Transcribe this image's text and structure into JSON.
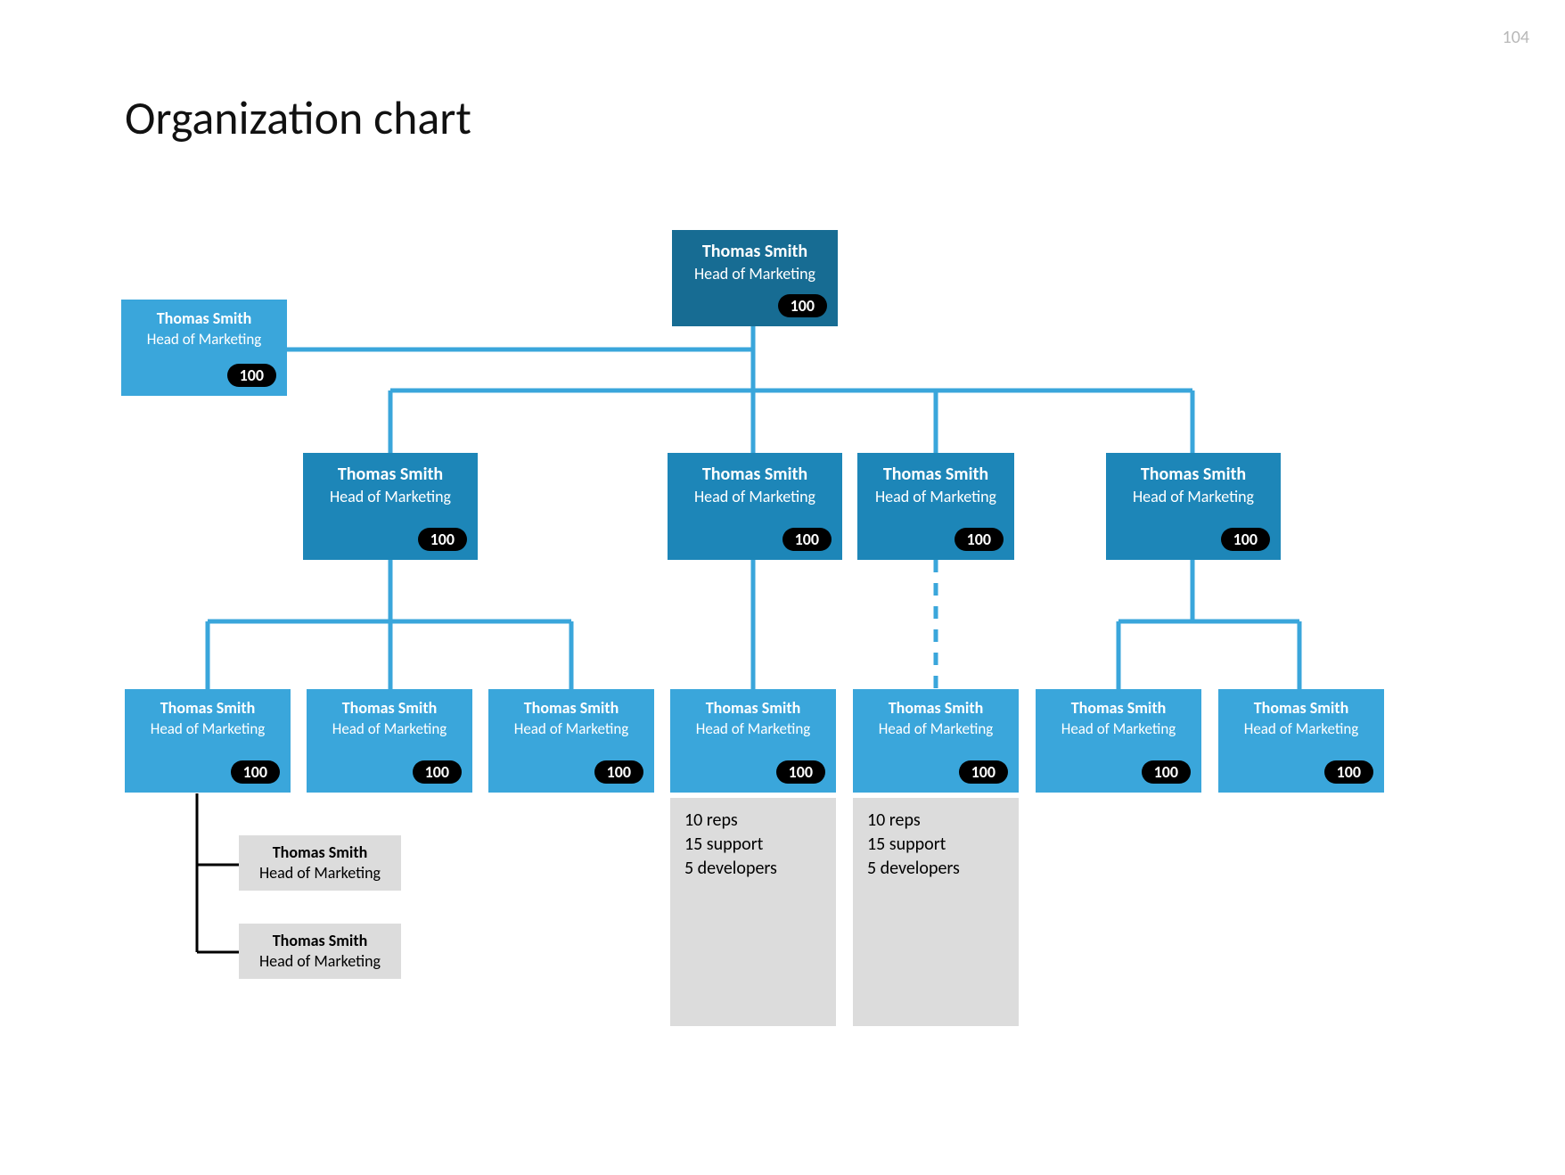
{
  "page_number": "104",
  "title": "Organization chart",
  "root": {
    "name": "Thomas Smith",
    "title": "Head of Marketing",
    "badge": "100"
  },
  "assistant": {
    "name": "Thomas Smith",
    "title": "Head of Marketing",
    "badge": "100"
  },
  "level2": [
    {
      "name": "Thomas Smith",
      "title": "Head of Marketing",
      "badge": "100"
    },
    {
      "name": "Thomas Smith",
      "title": "Head of Marketing",
      "badge": "100"
    },
    {
      "name": "Thomas Smith",
      "title": "Head of Marketing",
      "badge": "100"
    },
    {
      "name": "Thomas Smith",
      "title": "Head of Marketing",
      "badge": "100"
    }
  ],
  "level3": [
    {
      "name": "Thomas Smith",
      "title": "Head of Marketing",
      "badge": "100"
    },
    {
      "name": "Thomas Smith",
      "title": "Head of Marketing",
      "badge": "100"
    },
    {
      "name": "Thomas Smith",
      "title": "Head of Marketing",
      "badge": "100"
    },
    {
      "name": "Thomas Smith",
      "title": "Head of Marketing",
      "badge": "100"
    },
    {
      "name": "Thomas Smith",
      "title": "Head of Marketing",
      "badge": "100"
    },
    {
      "name": "Thomas Smith",
      "title": "Head of Marketing",
      "badge": "100"
    },
    {
      "name": "Thomas Smith",
      "title": "Head of Marketing",
      "badge": "100"
    }
  ],
  "subordinates": [
    {
      "name": "Thomas Smith",
      "title": "Head of Marketing"
    },
    {
      "name": "Thomas Smith",
      "title": "Head of Marketing"
    }
  ],
  "footnotes": [
    {
      "line1": "10 reps",
      "line2": "15 support",
      "line3": "5 developers"
    },
    {
      "line1": "10 reps",
      "line2": "15 support",
      "line3": "5 developers"
    }
  ]
}
